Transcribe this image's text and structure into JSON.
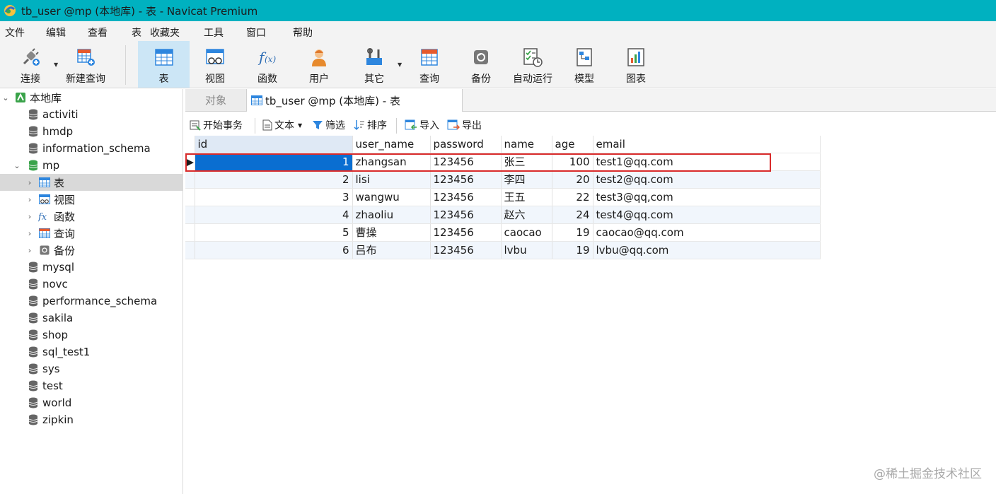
{
  "window": {
    "title": "tb_user @mp (本地库) - 表 - Navicat Premium"
  },
  "menu": [
    "文件",
    "编辑",
    "查看",
    "表",
    "收藏夹",
    "工具",
    "窗口",
    "帮助"
  ],
  "toolbar": {
    "connect": "连接",
    "new_query": "新建查询",
    "table": "表",
    "view": "视图",
    "function": "函数",
    "user": "用户",
    "other": "其它",
    "query": "查询",
    "backup": "备份",
    "autorun": "自动运行",
    "model": "模型",
    "chart": "图表"
  },
  "tree": {
    "root": "本地库",
    "databases": [
      "activiti",
      "hmdp",
      "information_schema",
      "mp",
      "mysql",
      "novc",
      "performance_schema",
      "sakila",
      "shop",
      "sql_test1",
      "sys",
      "test",
      "world",
      "zipkin"
    ],
    "mp_children": [
      "表",
      "视图",
      "函数",
      "查询",
      "备份"
    ]
  },
  "tabs": {
    "objects": "对象",
    "active": "tb_user @mp (本地库) - 表"
  },
  "subtoolbar": {
    "begin_transaction": "开始事务",
    "text": "文本",
    "filter": "筛选",
    "sort": "排序",
    "import": "导入",
    "export": "导出"
  },
  "grid": {
    "columns": [
      "id",
      "user_name",
      "password",
      "name",
      "age",
      "email"
    ],
    "rows": [
      [
        "1",
        "zhangsan",
        "123456",
        "张三",
        "100",
        "test1@qq.com"
      ],
      [
        "2",
        "lisi",
        "123456",
        "李四",
        "20",
        "test2@qq.com"
      ],
      [
        "3",
        "wangwu",
        "123456",
        "王五",
        "22",
        "test3@qq,com"
      ],
      [
        "4",
        "zhaoliu",
        "123456",
        "赵六",
        "24",
        "test4@qq.com"
      ],
      [
        "5",
        "曹操",
        "123456",
        "caocao",
        "19",
        "caocao@qq.com"
      ],
      [
        "6",
        "吕布",
        "123456",
        "lvbu",
        "19",
        "lvbu@qq.com"
      ]
    ]
  },
  "watermark": "@稀土掘金技术社区",
  "colors": {
    "titlebar": "#00b1c0",
    "selection": "#0a6ed1",
    "highlight": "#d92b2b"
  }
}
